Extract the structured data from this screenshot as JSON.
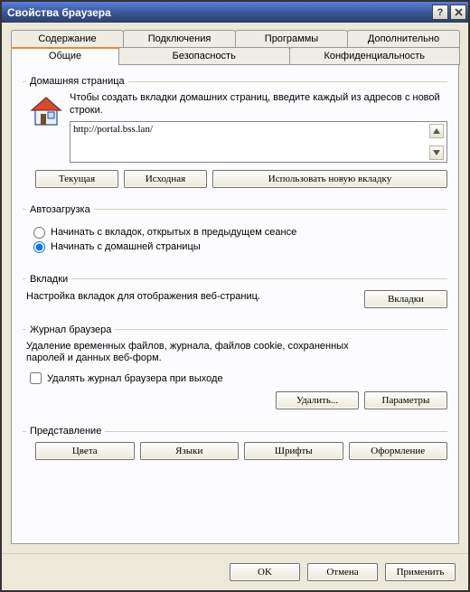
{
  "window": {
    "title": "Свойства браузера"
  },
  "tabs": {
    "row1": [
      "Содержание",
      "Подключения",
      "Программы",
      "Дополнительно"
    ],
    "row2": [
      "Общие",
      "Безопасность",
      "Конфиденциальность"
    ],
    "active": "Общие"
  },
  "home": {
    "legend": "Домашняя страница",
    "desc": "Чтобы создать вкладки домашних страниц, введите каждый из адресов с новой строки.",
    "url": "http://portal.bss.lan/",
    "btn_current": "Текущая",
    "btn_default": "Исходная",
    "btn_newtab": "Использовать новую вкладку"
  },
  "startup": {
    "legend": "Автозагрузка",
    "opt_last": "Начинать с вкладок, открытых в предыдущем сеансе",
    "opt_home": "Начинать с домашней страницы"
  },
  "tabs_section": {
    "legend": "Вкладки",
    "desc": "Настройка вкладок для отображения веб-страниц.",
    "btn": "Вкладки"
  },
  "history": {
    "legend": "Журнал браузера",
    "desc": "Удаление временных файлов, журнала, файлов cookie, сохраненных паролей и данных веб-форм.",
    "chk": "Удалять журнал браузера при выходе",
    "btn_delete": "Удалить...",
    "btn_params": "Параметры"
  },
  "appearance": {
    "legend": "Представление",
    "btn_colors": "Цвета",
    "btn_lang": "Языки",
    "btn_fonts": "Шрифты",
    "btn_acc": "Оформление"
  },
  "bottom": {
    "ok": "OK",
    "cancel": "Отмена",
    "apply": "Применить"
  }
}
